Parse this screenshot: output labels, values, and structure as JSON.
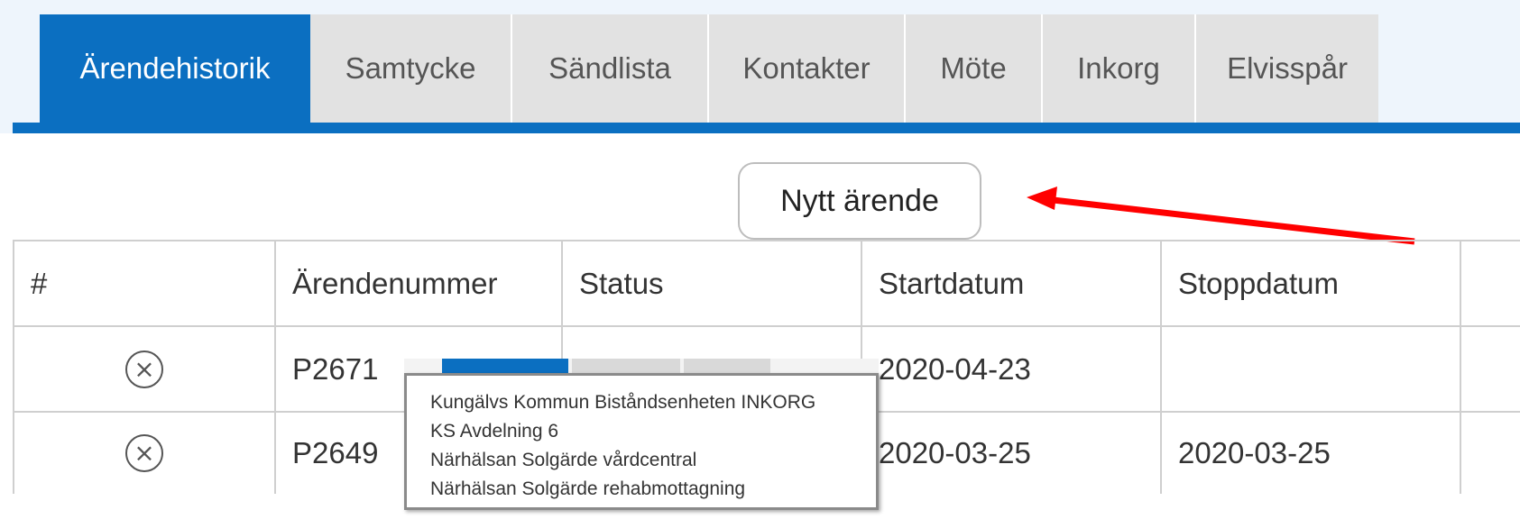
{
  "tabs": [
    {
      "label": "Ärendehistorik",
      "active": true
    },
    {
      "label": "Samtycke",
      "active": false
    },
    {
      "label": "Sändlista",
      "active": false
    },
    {
      "label": "Kontakter",
      "active": false
    },
    {
      "label": "Möte",
      "active": false
    },
    {
      "label": "Inkorg",
      "active": false
    },
    {
      "label": "Elvisspår",
      "active": false
    }
  ],
  "new_case_button": "Nytt ärende",
  "table": {
    "headers": [
      "#",
      "Ärendenummer",
      "Status",
      "Startdatum",
      "Stoppdatum",
      ""
    ],
    "rows": [
      {
        "icon": "close-circle-icon",
        "number": "P2671",
        "status": "",
        "start": "2020-04-23",
        "stop": ""
      },
      {
        "icon": "close-circle-icon",
        "number": "P2649",
        "status": "",
        "start": "2020-03-25",
        "stop": "2020-03-25"
      }
    ]
  },
  "tooltip": {
    "lines": [
      "Kungälvs Kommun Biståndsenheten INKORG",
      "KS Avdelning 6",
      "Närhälsan Solgärde vårdcentral",
      "Närhälsan Solgärde rehabmottagning"
    ]
  },
  "colors": {
    "accent": "#0b6fc1",
    "tab_inactive": "#e2e2e2",
    "annotation_arrow": "#ff0000"
  }
}
